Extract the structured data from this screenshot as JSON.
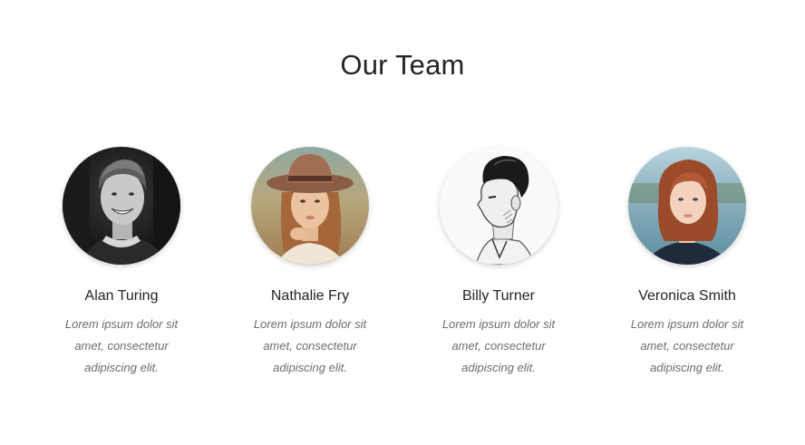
{
  "section": {
    "title": "Our Team"
  },
  "members": [
    {
      "name": "Alan Turing",
      "bio": "Lorem ipsum dolor sit amet, consectetur adipiscing elit.",
      "photo": "man-smiling-bw-photo"
    },
    {
      "name": "Nathalie Fry",
      "bio": "Lorem ipsum dolor sit amet, consectetur adipiscing elit.",
      "photo": "woman-in-hat-photo"
    },
    {
      "name": "Billy Turner",
      "bio": "Lorem ipsum dolor sit amet, consectetur adipiscing elit.",
      "photo": "man-sketch-profile-photo"
    },
    {
      "name": "Veronica Smith",
      "bio": "Lorem ipsum dolor sit amet, consectetur adipiscing elit.",
      "photo": "red-haired-woman-photo"
    }
  ],
  "colors": {
    "heading": "#212529",
    "bio_text": "#6c6c6c",
    "background": "#ffffff"
  }
}
